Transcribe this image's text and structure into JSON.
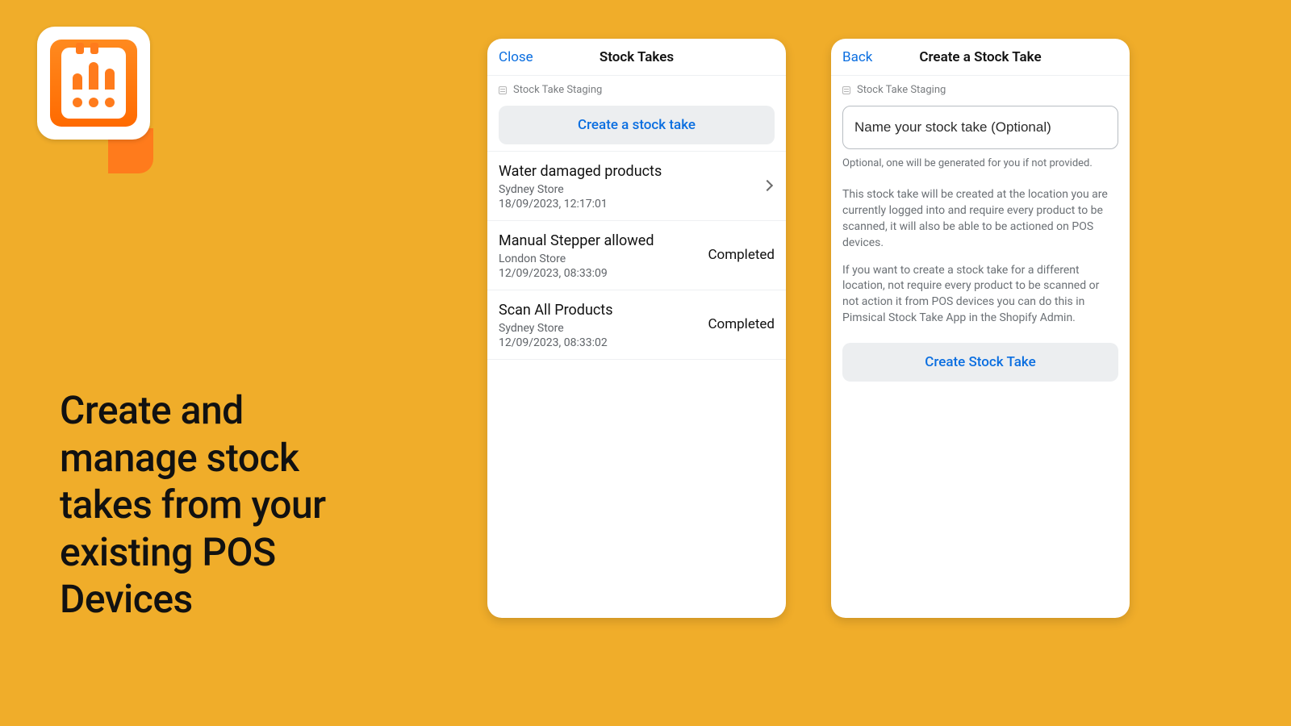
{
  "tagline": "Create and manage stock takes from your existing POS Devices",
  "leftPanel": {
    "close": "Close",
    "title": "Stock Takes",
    "breadcrumb": "Stock Take Staging",
    "createButton": "Create a stock take",
    "items": [
      {
        "name": "Water damaged products",
        "location": "Sydney Store",
        "timestamp": "18/09/2023, 12:17:01",
        "status": "",
        "hasChevron": true
      },
      {
        "name": "Manual Stepper allowed",
        "location": "London Store",
        "timestamp": "12/09/2023, 08:33:09",
        "status": "Completed",
        "hasChevron": false
      },
      {
        "name": "Scan All Products",
        "location": "Sydney Store",
        "timestamp": "12/09/2023, 08:33:02",
        "status": "Completed",
        "hasChevron": false
      }
    ]
  },
  "rightPanel": {
    "back": "Back",
    "title": "Create a Stock Take",
    "breadcrumb": "Stock Take Staging",
    "placeholder": "Name your stock take (Optional)",
    "helper": "Optional, one will be generated for you if not provided.",
    "para1": "This stock take will be created at the location you are currently logged into and require every product to be scanned, it will also be able to be actioned on POS devices.",
    "para2": "If you want to create a stock take for a different location, not require every product to be scanned or not action it from POS devices you can do this in Pimsical Stock Take App in the Shopify Admin.",
    "cta": "Create Stock Take"
  }
}
